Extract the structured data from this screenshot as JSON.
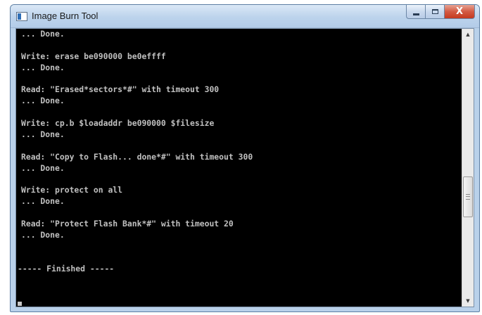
{
  "window": {
    "title": "Image Burn Tool"
  },
  "titlebar": {
    "icon": "app-window-icon",
    "minimize_icon": "minimize-icon",
    "maximize_icon": "maximize-icon",
    "close_icon": "close-icon",
    "close_glyph": "X"
  },
  "console": {
    "lines": [
      "... Done.",
      "",
      "Write: erase be090000 be0effff",
      "... Done.",
      "",
      "Read: \"Erased*sectors*#\" with timeout 300",
      "... Done.",
      "",
      "Write: cp.b $loadaddr be090000 $filesize",
      "... Done.",
      "",
      "Read: \"Copy to Flash... done*#\" with timeout 300",
      "... Done.",
      "",
      "Write: protect on all",
      "... Done.",
      "",
      "Read: \"Protect Flash Bank*#\" with timeout 20",
      "... Done.",
      "",
      "",
      "----- Finished -----"
    ],
    "colors": {
      "background": "#000000",
      "text": "#c0c0c0"
    }
  },
  "scrollbar": {
    "up_arrow": "▲",
    "down_arrow": "▼"
  }
}
